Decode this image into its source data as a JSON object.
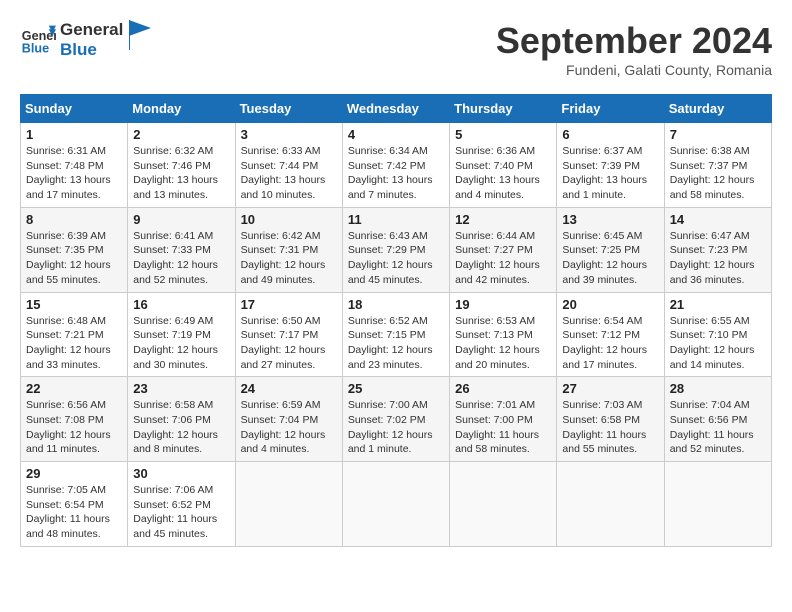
{
  "logo": {
    "line1": "General",
    "line2": "Blue"
  },
  "title": "September 2024",
  "subtitle": "Fundeni, Galati County, Romania",
  "days_of_week": [
    "Sunday",
    "Monday",
    "Tuesday",
    "Wednesday",
    "Thursday",
    "Friday",
    "Saturday"
  ],
  "weeks": [
    [
      {
        "day": "1",
        "detail": "Sunrise: 6:31 AM\nSunset: 7:48 PM\nDaylight: 13 hours\nand 17 minutes."
      },
      {
        "day": "2",
        "detail": "Sunrise: 6:32 AM\nSunset: 7:46 PM\nDaylight: 13 hours\nand 13 minutes."
      },
      {
        "day": "3",
        "detail": "Sunrise: 6:33 AM\nSunset: 7:44 PM\nDaylight: 13 hours\nand 10 minutes."
      },
      {
        "day": "4",
        "detail": "Sunrise: 6:34 AM\nSunset: 7:42 PM\nDaylight: 13 hours\nand 7 minutes."
      },
      {
        "day": "5",
        "detail": "Sunrise: 6:36 AM\nSunset: 7:40 PM\nDaylight: 13 hours\nand 4 minutes."
      },
      {
        "day": "6",
        "detail": "Sunrise: 6:37 AM\nSunset: 7:39 PM\nDaylight: 13 hours\nand 1 minute."
      },
      {
        "day": "7",
        "detail": "Sunrise: 6:38 AM\nSunset: 7:37 PM\nDaylight: 12 hours\nand 58 minutes."
      }
    ],
    [
      {
        "day": "8",
        "detail": "Sunrise: 6:39 AM\nSunset: 7:35 PM\nDaylight: 12 hours\nand 55 minutes."
      },
      {
        "day": "9",
        "detail": "Sunrise: 6:41 AM\nSunset: 7:33 PM\nDaylight: 12 hours\nand 52 minutes."
      },
      {
        "day": "10",
        "detail": "Sunrise: 6:42 AM\nSunset: 7:31 PM\nDaylight: 12 hours\nand 49 minutes."
      },
      {
        "day": "11",
        "detail": "Sunrise: 6:43 AM\nSunset: 7:29 PM\nDaylight: 12 hours\nand 45 minutes."
      },
      {
        "day": "12",
        "detail": "Sunrise: 6:44 AM\nSunset: 7:27 PM\nDaylight: 12 hours\nand 42 minutes."
      },
      {
        "day": "13",
        "detail": "Sunrise: 6:45 AM\nSunset: 7:25 PM\nDaylight: 12 hours\nand 39 minutes."
      },
      {
        "day": "14",
        "detail": "Sunrise: 6:47 AM\nSunset: 7:23 PM\nDaylight: 12 hours\nand 36 minutes."
      }
    ],
    [
      {
        "day": "15",
        "detail": "Sunrise: 6:48 AM\nSunset: 7:21 PM\nDaylight: 12 hours\nand 33 minutes."
      },
      {
        "day": "16",
        "detail": "Sunrise: 6:49 AM\nSunset: 7:19 PM\nDaylight: 12 hours\nand 30 minutes."
      },
      {
        "day": "17",
        "detail": "Sunrise: 6:50 AM\nSunset: 7:17 PM\nDaylight: 12 hours\nand 27 minutes."
      },
      {
        "day": "18",
        "detail": "Sunrise: 6:52 AM\nSunset: 7:15 PM\nDaylight: 12 hours\nand 23 minutes."
      },
      {
        "day": "19",
        "detail": "Sunrise: 6:53 AM\nSunset: 7:13 PM\nDaylight: 12 hours\nand 20 minutes."
      },
      {
        "day": "20",
        "detail": "Sunrise: 6:54 AM\nSunset: 7:12 PM\nDaylight: 12 hours\nand 17 minutes."
      },
      {
        "day": "21",
        "detail": "Sunrise: 6:55 AM\nSunset: 7:10 PM\nDaylight: 12 hours\nand 14 minutes."
      }
    ],
    [
      {
        "day": "22",
        "detail": "Sunrise: 6:56 AM\nSunset: 7:08 PM\nDaylight: 12 hours\nand 11 minutes."
      },
      {
        "day": "23",
        "detail": "Sunrise: 6:58 AM\nSunset: 7:06 PM\nDaylight: 12 hours\nand 8 minutes."
      },
      {
        "day": "24",
        "detail": "Sunrise: 6:59 AM\nSunset: 7:04 PM\nDaylight: 12 hours\nand 4 minutes."
      },
      {
        "day": "25",
        "detail": "Sunrise: 7:00 AM\nSunset: 7:02 PM\nDaylight: 12 hours\nand 1 minute."
      },
      {
        "day": "26",
        "detail": "Sunrise: 7:01 AM\nSunset: 7:00 PM\nDaylight: 11 hours\nand 58 minutes."
      },
      {
        "day": "27",
        "detail": "Sunrise: 7:03 AM\nSunset: 6:58 PM\nDaylight: 11 hours\nand 55 minutes."
      },
      {
        "day": "28",
        "detail": "Sunrise: 7:04 AM\nSunset: 6:56 PM\nDaylight: 11 hours\nand 52 minutes."
      }
    ],
    [
      {
        "day": "29",
        "detail": "Sunrise: 7:05 AM\nSunset: 6:54 PM\nDaylight: 11 hours\nand 48 minutes."
      },
      {
        "day": "30",
        "detail": "Sunrise: 7:06 AM\nSunset: 6:52 PM\nDaylight: 11 hours\nand 45 minutes."
      },
      {
        "day": "",
        "detail": ""
      },
      {
        "day": "",
        "detail": ""
      },
      {
        "day": "",
        "detail": ""
      },
      {
        "day": "",
        "detail": ""
      },
      {
        "day": "",
        "detail": ""
      }
    ]
  ]
}
